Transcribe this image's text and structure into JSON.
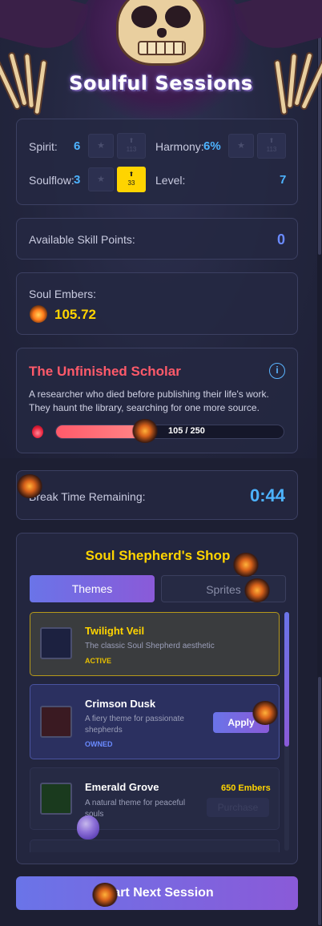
{
  "app": {
    "title": "Soulful Sessions"
  },
  "stats": {
    "spirit": {
      "label": "Spirit:",
      "value": "6",
      "upgrade_cost": "113"
    },
    "harmony": {
      "label": "Harmony:",
      "value": "6%",
      "upgrade_cost": "113"
    },
    "soulflow": {
      "label": "Soulflow:",
      "value": "3",
      "upgrade_cost": "33"
    },
    "level": {
      "label": "Level:",
      "value": "7"
    },
    "star_glyph": "★",
    "arrow_glyph": "⬆"
  },
  "skill_points": {
    "label": "Available Skill Points:",
    "value": "0"
  },
  "soul_embers": {
    "label": "Soul Embers:",
    "value": "105.72"
  },
  "soul": {
    "name": "The Unfinished Scholar",
    "description": "A researcher who died before publishing their life's work. They haunt the library, searching for one more source.",
    "progress_text": "105 / 250",
    "progress_current": 105,
    "progress_max": 250,
    "info_glyph": "i"
  },
  "break_timer": {
    "label": "Break Time Remaining:",
    "value": "0:44"
  },
  "shop": {
    "title": "Soul Shepherd's Shop",
    "tabs": [
      {
        "label": "Themes",
        "active": true
      },
      {
        "label": "Sprites",
        "active": false
      }
    ],
    "themes": [
      {
        "name": "Twilight Veil",
        "description": "The classic Soul Shepherd aesthetic",
        "status": "ACTIVE",
        "swatch": "#1c2140"
      },
      {
        "name": "Crimson Dusk",
        "description": "A fiery theme for passionate shepherds",
        "status": "OWNED",
        "swatch": "#3a1a22",
        "action": "Apply"
      },
      {
        "name": "Emerald Grove",
        "description": "A natural theme for peaceful souls",
        "price": "650 Embers",
        "action": "Purchase",
        "swatch": "#1a3a1e"
      }
    ]
  },
  "start_button": {
    "label": "Start Next Session"
  },
  "colors": {
    "accent": "#4db3ff",
    "gold": "#ffd400",
    "soul_title": "#ff5a6a",
    "active_status": "#e8c000",
    "owned_status": "#6a8aff"
  }
}
